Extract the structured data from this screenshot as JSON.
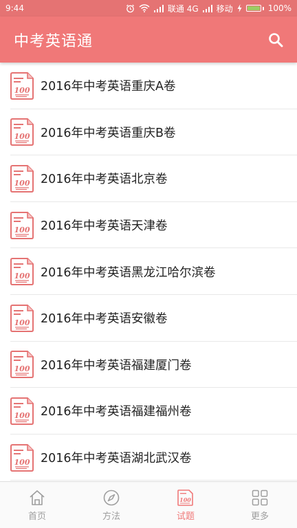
{
  "status_bar": {
    "time": "9:44",
    "carrier1": "联通 4G",
    "carrier2": "移动",
    "battery": "100%"
  },
  "app_bar": {
    "title": "中考英语通",
    "search_icon": "search-icon"
  },
  "list": {
    "icon": "exam-paper-icon",
    "items": [
      {
        "label": "2016年中考英语重庆A卷"
      },
      {
        "label": "2016年中考英语重庆B卷"
      },
      {
        "label": "2016年中考英语北京卷"
      },
      {
        "label": "2016年中考英语天津卷"
      },
      {
        "label": "2016年中考英语黑龙江哈尔滨卷"
      },
      {
        "label": "2016年中考英语安徽卷"
      },
      {
        "label": "2016年中考英语福建厦门卷"
      },
      {
        "label": "2016年中考英语福建福州卷"
      },
      {
        "label": "2016年中考英语湖北武汉卷"
      }
    ]
  },
  "bottom_nav": {
    "tabs": [
      {
        "label": "首页",
        "icon": "home-icon"
      },
      {
        "label": "方法",
        "icon": "compass-icon"
      },
      {
        "label": "试题",
        "icon": "exam-paper-icon",
        "active": true
      },
      {
        "label": "更多",
        "icon": "grid-icon"
      }
    ]
  },
  "colors": {
    "primary": "#f07878",
    "status_bar": "#e57373",
    "inactive": "#9e9e9e"
  }
}
